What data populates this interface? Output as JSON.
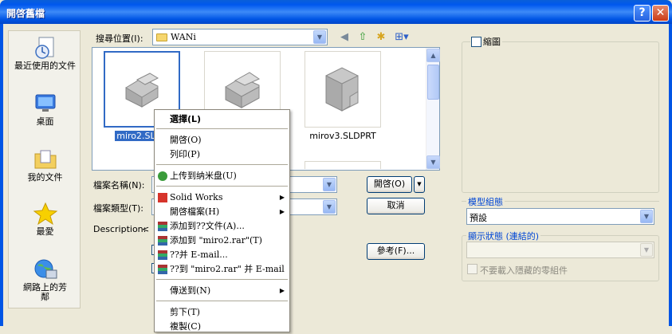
{
  "window": {
    "title": "開啓舊檔",
    "help_label": "?",
    "close_label": "✕"
  },
  "places": [
    {
      "label": "最近使用的文件",
      "icon": "recent-documents-icon"
    },
    {
      "label": "桌面",
      "icon": "desktop-icon"
    },
    {
      "label": "我的文件",
      "icon": "my-documents-icon"
    },
    {
      "label": "最愛",
      "icon": "favorites-star-icon"
    },
    {
      "label": "網路上的芳鄰",
      "icon": "network-places-icon"
    }
  ],
  "lookin": {
    "label": "搜尋位置(I):",
    "value": "WANi"
  },
  "files": [
    {
      "name": "miro2.SLDP",
      "selected": true
    },
    {
      "name": "",
      "selected": false
    },
    {
      "name": "mirov3.SLDPRT",
      "selected": false
    }
  ],
  "form": {
    "filename_label": "檔案名稱(N):",
    "filetype_label": "檔案類型(T):",
    "description_label": "Description:",
    "description_value": "<"
  },
  "buttons": {
    "open": "開啓(O)",
    "cancel": "取消",
    "reference": "參考(F)..."
  },
  "right_panel": {
    "thumbnail_label": "縮圖",
    "config_title": "模型組態",
    "config_value": "預設",
    "display_state_title": "顯示狀態 (連結的)",
    "display_state_value": "",
    "no_load_hidden_label": "不要載入隱藏的零組件"
  },
  "context_menu": {
    "items": [
      {
        "label": "選擇(L)",
        "bold": true
      },
      {
        "label": "開啓(O)"
      },
      {
        "label": "列印(P)"
      },
      {
        "label": "上传到纳米盘(U)",
        "icon": "upload-icon"
      },
      {
        "label": "Solid Works",
        "submenu": true,
        "icon": "solidworks-icon"
      },
      {
        "label": "開啓檔案(H)",
        "submenu": true
      },
      {
        "label": "添加到??文件(A)...",
        "icon": "winrar-icon"
      },
      {
        "label": "添加到 \"miro2.rar\"(T)",
        "icon": "winrar-icon"
      },
      {
        "label": "??并 E-mail...",
        "icon": "winrar-icon"
      },
      {
        "label": "??到 \"miro2.rar\" 并 E-mail",
        "icon": "winrar-icon"
      },
      {
        "label": "傳送到(N)",
        "submenu": true
      },
      {
        "label": "剪下(T)"
      },
      {
        "label": "複製(C)"
      }
    ]
  },
  "colors": {
    "titlebar": "#0058ee",
    "selection": "#316ac5",
    "group_title": "#0046d5"
  }
}
